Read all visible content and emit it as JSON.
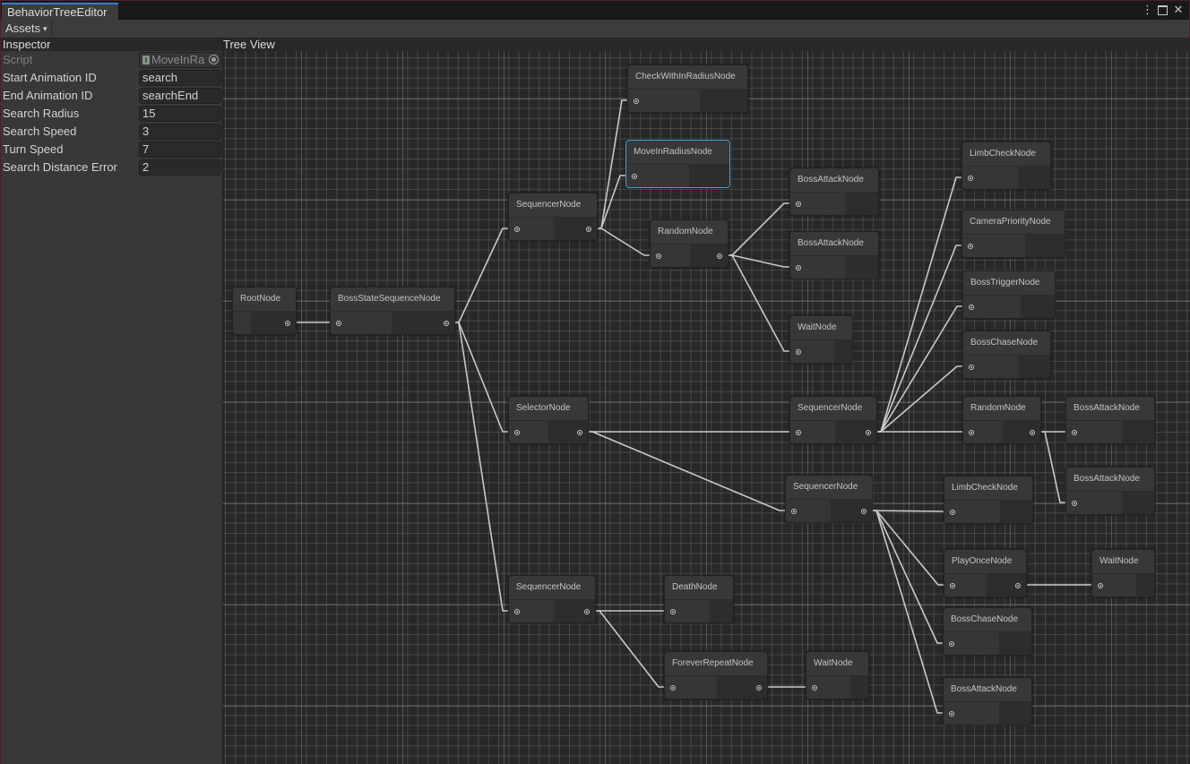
{
  "window": {
    "tab_title": "BehaviorTreeEditor",
    "more_icon": "kebab-menu-icon",
    "maximize_icon": "maximize-icon",
    "close_icon": "close-icon"
  },
  "toolbar": {
    "assets_label": "Assets",
    "assets_caret": "▾"
  },
  "inspector": {
    "title": "Inspector",
    "fields": [
      {
        "label": "Script",
        "value": "MoveInRadiusNode",
        "display": "MoveInRa",
        "kind": "object",
        "disabled": true
      },
      {
        "label": "Start Animation ID",
        "value": "search",
        "kind": "text"
      },
      {
        "label": "End Animation ID",
        "value": "searchEnd",
        "kind": "text"
      },
      {
        "label": "Search Radius",
        "value": "15",
        "kind": "number"
      },
      {
        "label": "Search Speed",
        "value": "3",
        "kind": "number"
      },
      {
        "label": "Turn Speed",
        "value": "7",
        "kind": "number"
      },
      {
        "label": "Search Distance Error",
        "value": "2",
        "kind": "number"
      }
    ]
  },
  "tree_view": {
    "title": "Tree View",
    "selected_node": "n4",
    "nodes": [
      {
        "id": "n0",
        "name": "RootNode",
        "has_input": false,
        "has_output": true
      },
      {
        "id": "n1",
        "name": "BossStateSequenceNode",
        "has_input": true,
        "has_output": true
      },
      {
        "id": "n2",
        "name": "SequencerNode",
        "has_input": true,
        "has_output": true
      },
      {
        "id": "n3",
        "name": "CheckWithInRadiusNode",
        "has_input": true,
        "has_output": false
      },
      {
        "id": "n4",
        "name": "MoveInRadiusNode",
        "has_input": true,
        "has_output": false
      },
      {
        "id": "n5",
        "name": "RandomNode",
        "has_input": true,
        "has_output": true
      },
      {
        "id": "n6",
        "name": "BossAttackNode",
        "has_input": true,
        "has_output": false
      },
      {
        "id": "n7",
        "name": "BossAttackNode",
        "has_input": true,
        "has_output": false
      },
      {
        "id": "n8",
        "name": "WaitNode",
        "has_input": true,
        "has_output": false
      },
      {
        "id": "n9",
        "name": "SelectorNode",
        "has_input": true,
        "has_output": true
      },
      {
        "id": "n10",
        "name": "SequencerNode",
        "has_input": true,
        "has_output": true
      },
      {
        "id": "n11",
        "name": "LimbCheckNode",
        "has_input": true,
        "has_output": false
      },
      {
        "id": "n12",
        "name": "CameraPriorityNode",
        "has_input": true,
        "has_output": false
      },
      {
        "id": "n13",
        "name": "BossTriggerNode",
        "has_input": true,
        "has_output": false
      },
      {
        "id": "n14",
        "name": "BossChaseNode",
        "has_input": true,
        "has_output": false
      },
      {
        "id": "n15",
        "name": "RandomNode",
        "has_input": true,
        "has_output": true
      },
      {
        "id": "n16",
        "name": "BossAttackNode",
        "has_input": true,
        "has_output": false
      },
      {
        "id": "n17",
        "name": "BossAttackNode",
        "has_input": true,
        "has_output": false
      },
      {
        "id": "n18",
        "name": "SequencerNode",
        "has_input": true,
        "has_output": true
      },
      {
        "id": "n19",
        "name": "LimbCheckNode",
        "has_input": true,
        "has_output": false
      },
      {
        "id": "n20",
        "name": "PlayOnceNode",
        "has_input": true,
        "has_output": true
      },
      {
        "id": "n21",
        "name": "WaitNode",
        "has_input": true,
        "has_output": false
      },
      {
        "id": "n22",
        "name": "BossChaseNode",
        "has_input": true,
        "has_output": false
      },
      {
        "id": "n23",
        "name": "BossAttackNode",
        "has_input": true,
        "has_output": false
      },
      {
        "id": "n24",
        "name": "SequencerNode",
        "has_input": true,
        "has_output": true
      },
      {
        "id": "n25",
        "name": "DeathNode",
        "has_input": true,
        "has_output": false
      },
      {
        "id": "n26",
        "name": "ForeverRepeatNode",
        "has_input": true,
        "has_output": true
      },
      {
        "id": "n27",
        "name": "WaitNode",
        "has_input": true,
        "has_output": false
      }
    ],
    "edges": [
      [
        "n0",
        "n1"
      ],
      [
        "n1",
        "n2"
      ],
      [
        "n1",
        "n9"
      ],
      [
        "n1",
        "n24"
      ],
      [
        "n2",
        "n3"
      ],
      [
        "n2",
        "n4"
      ],
      [
        "n2",
        "n5"
      ],
      [
        "n5",
        "n6"
      ],
      [
        "n5",
        "n7"
      ],
      [
        "n5",
        "n8"
      ],
      [
        "n9",
        "n10"
      ],
      [
        "n9",
        "n18"
      ],
      [
        "n10",
        "n11"
      ],
      [
        "n10",
        "n12"
      ],
      [
        "n10",
        "n13"
      ],
      [
        "n10",
        "n14"
      ],
      [
        "n10",
        "n15"
      ],
      [
        "n15",
        "n16"
      ],
      [
        "n15",
        "n17"
      ],
      [
        "n18",
        "n19"
      ],
      [
        "n18",
        "n20"
      ],
      [
        "n18",
        "n22"
      ],
      [
        "n18",
        "n23"
      ],
      [
        "n20",
        "n21"
      ],
      [
        "n24",
        "n25"
      ],
      [
        "n24",
        "n26"
      ],
      [
        "n26",
        "n27"
      ]
    ]
  },
  "colors": {
    "selection_outline": "#3aa2d6",
    "tab_accent": "#3a7ec8",
    "edge": "#c8c8c8"
  }
}
